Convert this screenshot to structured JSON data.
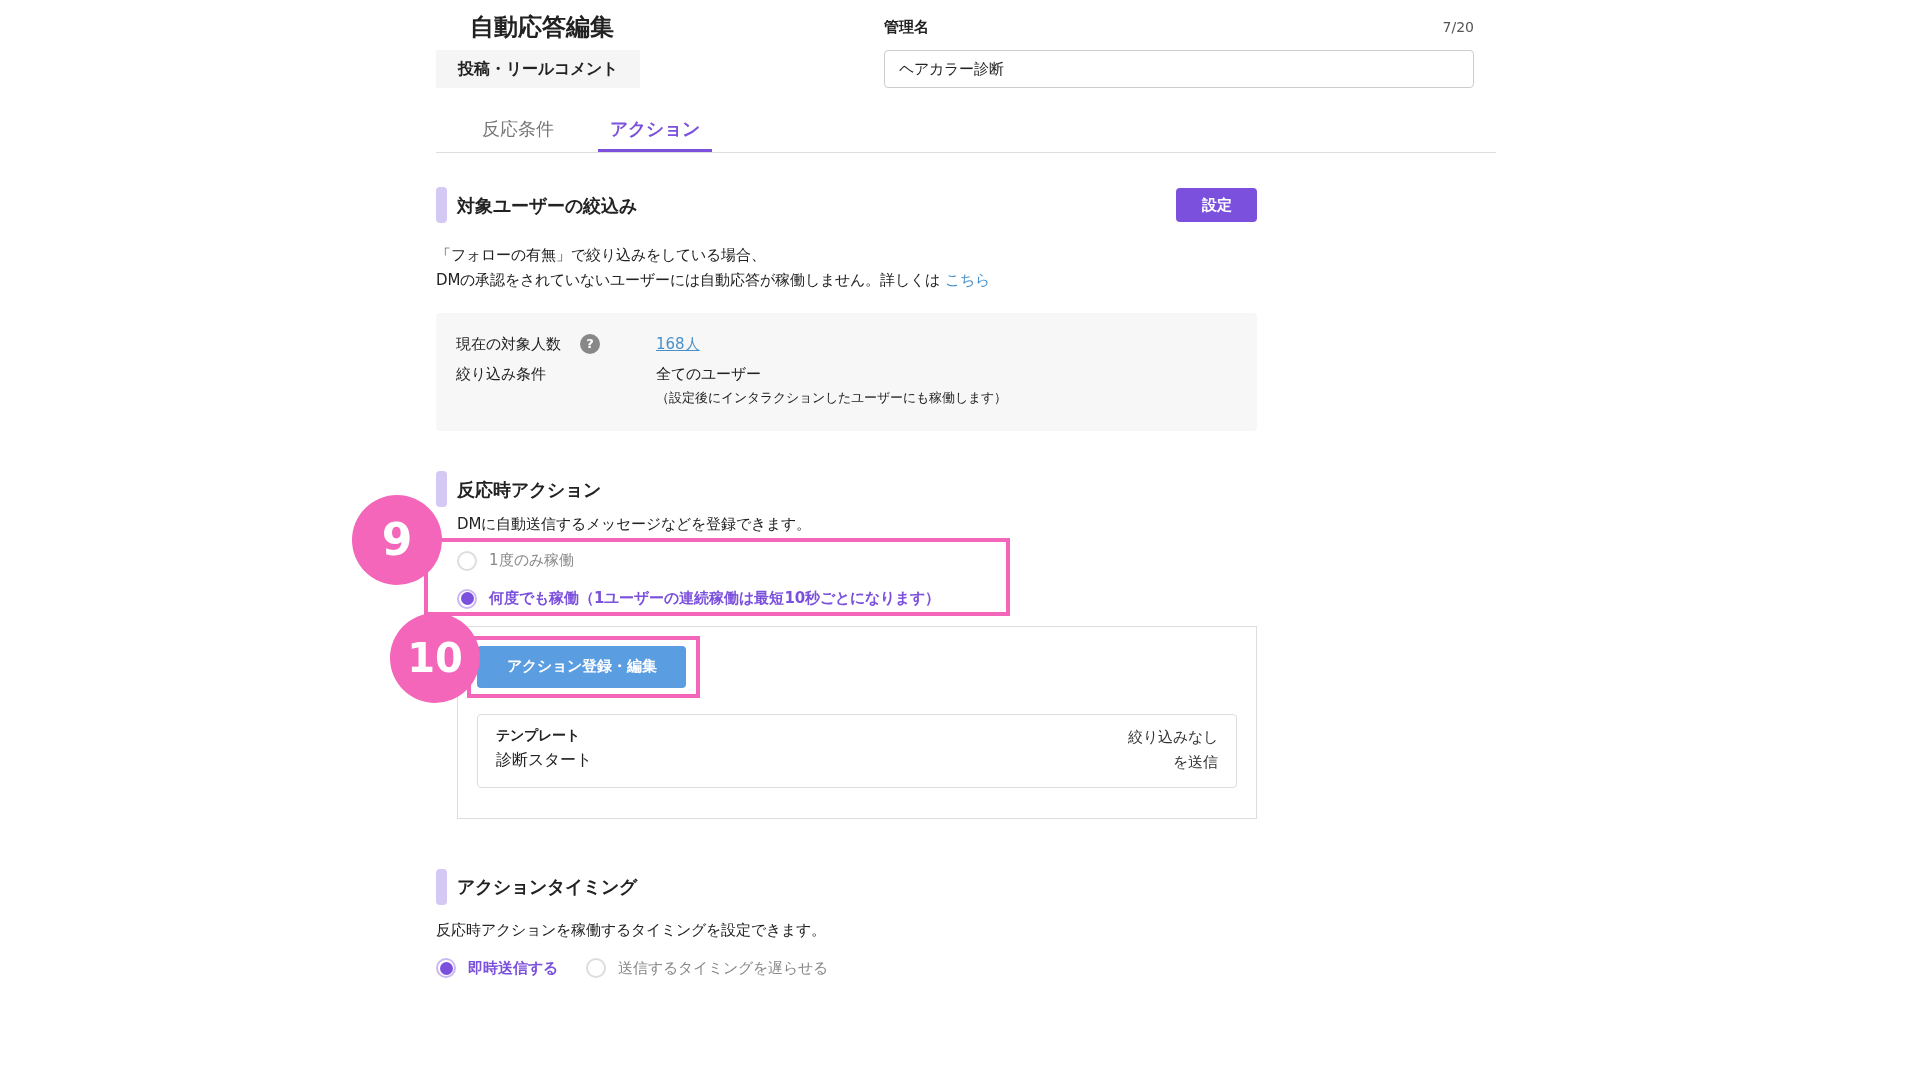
{
  "header": {
    "title": "自動応答編集",
    "type_chip": "投稿・リールコメント",
    "name_label": "管理名",
    "name_counter": "7/20",
    "name_value": "ヘアカラー診断"
  },
  "tabs": [
    {
      "label": "反応条件",
      "selected": false
    },
    {
      "label": "アクション",
      "selected": true
    }
  ],
  "target_filter": {
    "heading": "対象ユーザーの絞込み",
    "button": "設定",
    "notice_line_1": "「フォローの有無」で絞り込みをしている場合、",
    "notice_line_2": "DMの承認をされていないユーザーには自動応答が稼働しません。詳しくは",
    "notice_link": "こちら",
    "count_label": "現在の対象人数",
    "help_mark": "?",
    "count_value": "168人",
    "condition_label": "絞り込み条件",
    "condition_value": "全てのユーザー",
    "condition_note": "（設定後にインタラクションしたユーザーにも稼働します）"
  },
  "reaction_action": {
    "heading": "反応時アクション",
    "description": "DMに自動送信するメッセージなどを登録できます。",
    "annotation": "9",
    "options": [
      {
        "label": "1度のみ稼働",
        "selected": false
      },
      {
        "label": "何度でも稼働（1ユーザーの連続稼働は最短10秒ごとになります）",
        "selected": true
      }
    ],
    "register_button": "アクション登録・編集",
    "button_annotation": "10",
    "template": {
      "label": "テンプレート",
      "name": "診断スタート",
      "summary_lines": [
        "絞り込みなし",
        "を送信"
      ]
    }
  },
  "action_timing": {
    "heading": "アクションタイミング",
    "description": "反応時アクションを稼働するタイミングを設定できます。",
    "options": [
      {
        "label": "即時送信する",
        "selected": true
      },
      {
        "label": "送信するタイミングを遅らせる",
        "selected": false
      }
    ]
  }
}
